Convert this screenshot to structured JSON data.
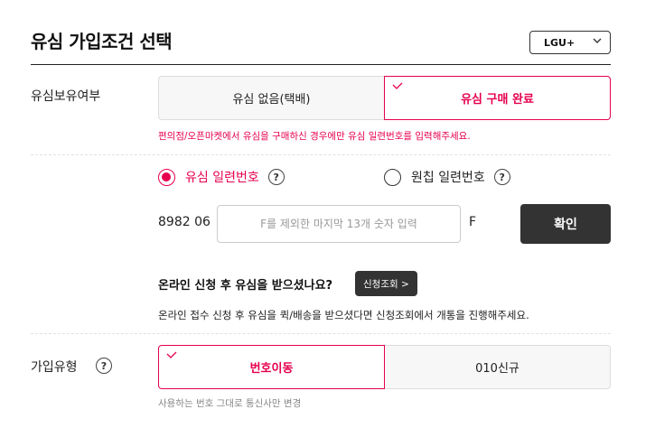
{
  "header": {
    "title": "유심 가입조건 선택",
    "carrier_select": "LGU+"
  },
  "usim_ownership": {
    "label": "유심보유여부",
    "options": [
      "유심 없음(택배)",
      "유심 구매 완료"
    ],
    "selected_index": 1,
    "note": "편의점/오픈마켓에서 유심을 구매하신 경우에만 유심 일련번호를 입력해주세요."
  },
  "serial": {
    "radio_options": [
      "유심 일련번호",
      "원칩 일련번호"
    ],
    "selected_index": 0,
    "help_glyph": "?",
    "prefix": "8982 06",
    "placeholder": "F를 제외한 마지막 13개 숫자 입력",
    "suffix": "F",
    "confirm_label": "확인"
  },
  "online_inquiry": {
    "question": "온라인 신청 후 유심을 받으셨나요?",
    "button_label": "신청조회 >",
    "description": "온라인 접수 신청 후 유심을 퀵/배송을 받으셨다면 신청조회에서 개통을 진행해주세요."
  },
  "signup_type": {
    "label": "가입유형",
    "options": [
      "번호이동",
      "010신규"
    ],
    "selected_index": 0,
    "note": "사용하는 번호 그대로 통신사만 변경"
  },
  "colors": {
    "accent": "#e6004d",
    "dark_button": "#333333"
  },
  "icons": [
    "chevron-down-icon",
    "check-icon",
    "help-icon"
  ]
}
